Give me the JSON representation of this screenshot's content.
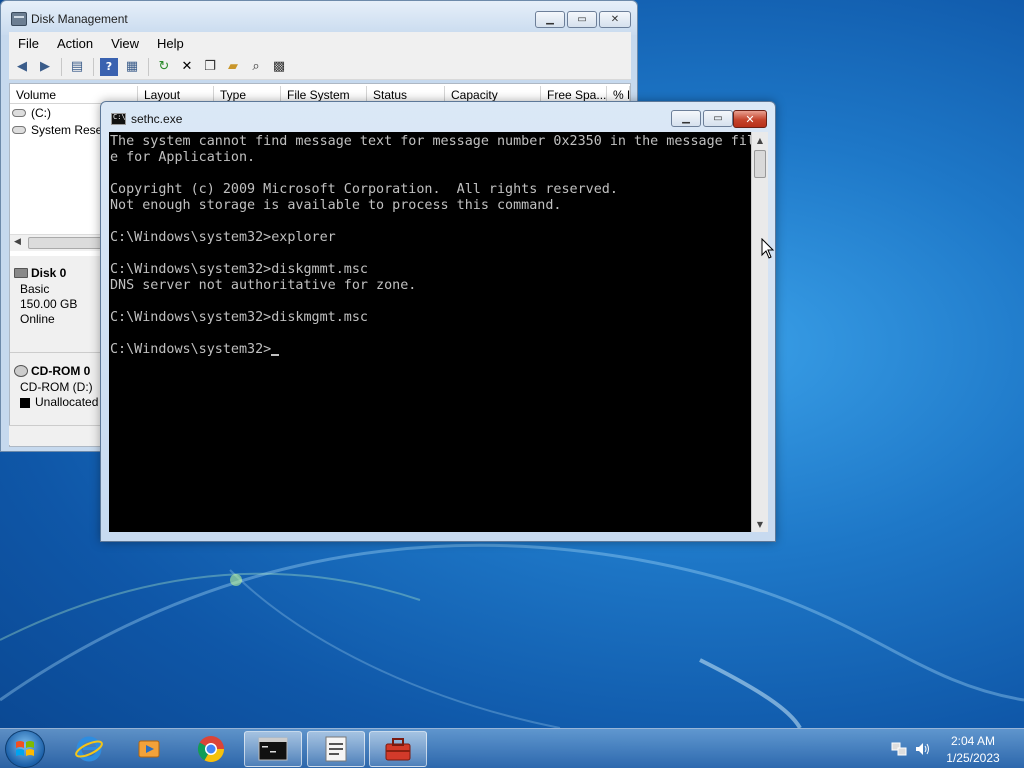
{
  "disk_management": {
    "title": "Disk Management",
    "menu": [
      "File",
      "Action",
      "View",
      "Help"
    ],
    "columns": [
      "Volume",
      "Layout",
      "Type",
      "File System",
      "Status",
      "Capacity",
      "Free Spa...",
      "% F"
    ],
    "volumes": [
      "(C:)",
      "System Reser"
    ],
    "disks": [
      {
        "name": "Disk 0",
        "type": "Basic",
        "size": "150.00 GB",
        "status": "Online"
      },
      {
        "name": "CD-ROM 0",
        "type": "CD-ROM (D:)",
        "status": "Unallocated"
      }
    ],
    "toolbar_icons": [
      "back-icon",
      "forward-icon",
      "console-tree-icon",
      "help-icon",
      "properties-icon",
      "refresh-icon",
      "delete-icon",
      "new-icon",
      "open-icon",
      "find-icon",
      "settings-icon"
    ]
  },
  "cmd": {
    "title": "sethc.exe",
    "lines": [
      "The system cannot find message text for message number 0x2350 in the message fil",
      "e for Application.",
      "",
      "Copyright (c) 2009 Microsoft Corporation.  All rights reserved.",
      "Not enough storage is available to process this command.",
      "",
      "C:\\Windows\\system32>explorer",
      "",
      "C:\\Windows\\system32>diskgmmt.msc",
      "DNS server not authoritative for zone.",
      "",
      "C:\\Windows\\system32>diskmgmt.msc",
      ""
    ],
    "prompt": "C:\\Windows\\system32>"
  },
  "taskbar": {
    "apps": [
      "internet-explorer-icon",
      "media-player-icon",
      "chrome-icon",
      "command-prompt-icon",
      "notepad-icon",
      "toolbox-icon"
    ],
    "time": "2:04 AM",
    "date": "1/25/2023"
  },
  "colors": {
    "cmd_text": "#c0c0c0",
    "cmd_background": "#000000",
    "close_button": "#c5442c",
    "desktop": "#1e78c8"
  }
}
